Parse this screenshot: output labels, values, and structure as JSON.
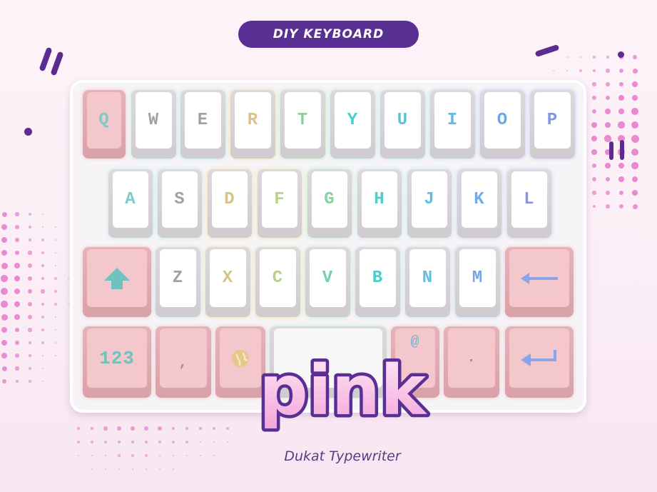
{
  "badge": {
    "label": "DIY KEYBOARD"
  },
  "keyboard": {
    "row1": [
      "Q",
      "W",
      "E",
      "R",
      "T",
      "Y",
      "U",
      "I",
      "O",
      "P"
    ],
    "row2": [
      "A",
      "S",
      "D",
      "F",
      "G",
      "H",
      "J",
      "K",
      "L"
    ],
    "row3": [
      "Z",
      "X",
      "C",
      "V",
      "B",
      "N",
      "M"
    ],
    "row4": {
      "numbers": "123",
      "comma": ",",
      "at": "@",
      "period": "."
    }
  },
  "title": {
    "word": "pink",
    "subtitle": "Dukat Typewriter"
  },
  "colors": {
    "accent_purple": "#5a2f93",
    "key_pink": "#f3c7cc",
    "key_white": "#ffffff",
    "dot_pink": "#e989cf",
    "letter_colors": {
      "Q": "#7fc9c8",
      "W": "#a4a0a4",
      "E": "#a4a0a4",
      "R": "#e0c08a",
      "T": "#8fd0a0",
      "Y": "#3fd0c7",
      "U": "#5bc2d8",
      "I": "#62b8e0",
      "O": "#6aa7e6",
      "P": "#7e96e8",
      "A": "#7fc9c8",
      "S": "#a4a0a4",
      "D": "#d8c08c",
      "F": "#bcd08a",
      "G": "#86d39c",
      "H": "#4fcfc8",
      "J": "#5ec0dc",
      "K": "#6faee4",
      "L": "#8596ea",
      "Z": "#a4a0a4",
      "X": "#d8c08c",
      "C": "#b7d08a",
      "V": "#6fd3a8",
      "B": "#3cd4cb",
      "N": "#5ec0dc",
      "M": "#7aa4e8"
    }
  },
  "icons": {
    "shift": "up-arrow-icon",
    "backspace": "left-arrow-icon",
    "globe": "globe-icon",
    "enter": "enter-icon"
  }
}
